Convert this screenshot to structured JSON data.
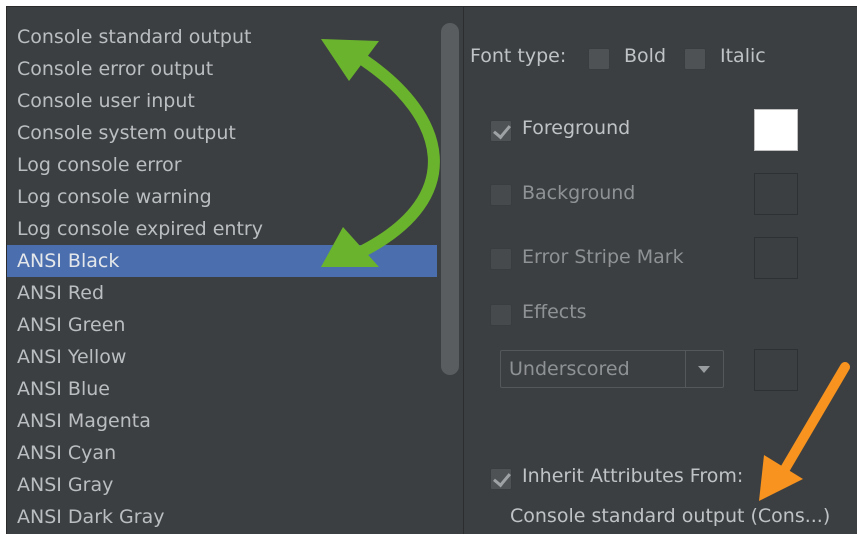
{
  "list": {
    "items": [
      {
        "label": "Console standard output",
        "selected": false
      },
      {
        "label": "Console error output",
        "selected": false
      },
      {
        "label": "Console user input",
        "selected": false
      },
      {
        "label": "Console system output",
        "selected": false
      },
      {
        "label": "Log console error",
        "selected": false
      },
      {
        "label": "Log console warning",
        "selected": false
      },
      {
        "label": "Log console expired entry",
        "selected": false
      },
      {
        "label": "ANSI Black",
        "selected": true
      },
      {
        "label": "ANSI Red",
        "selected": false
      },
      {
        "label": "ANSI Green",
        "selected": false
      },
      {
        "label": "ANSI Yellow",
        "selected": false
      },
      {
        "label": "ANSI Blue",
        "selected": false
      },
      {
        "label": "ANSI Magenta",
        "selected": false
      },
      {
        "label": "ANSI Cyan",
        "selected": false
      },
      {
        "label": "ANSI Gray",
        "selected": false
      },
      {
        "label": "ANSI Dark Gray",
        "selected": false
      }
    ]
  },
  "font_type": {
    "label": "Font type:",
    "bold_label": "Bold",
    "bold_checked": false,
    "italic_label": "Italic",
    "italic_checked": false
  },
  "attributes": {
    "foreground": {
      "label": "Foreground",
      "checked": true,
      "color": "#ffffff"
    },
    "background": {
      "label": "Background",
      "checked": false
    },
    "error_stripe": {
      "label": "Error Stripe Mark",
      "checked": false
    },
    "effects": {
      "label": "Effects",
      "checked": false,
      "dropdown_value": "Underscored"
    }
  },
  "inherit": {
    "label": "Inherit Attributes From:",
    "checked": true,
    "source": "Console standard output (Cons...)"
  },
  "colors": {
    "selection": "#4b6eaf",
    "annotation_green": "#6ab42d",
    "annotation_orange": "#f7931e"
  },
  "icons": [
    "chevron-down-icon",
    "checkmark-icon",
    "curved-double-arrow-annotation",
    "arrow-annotation"
  ]
}
